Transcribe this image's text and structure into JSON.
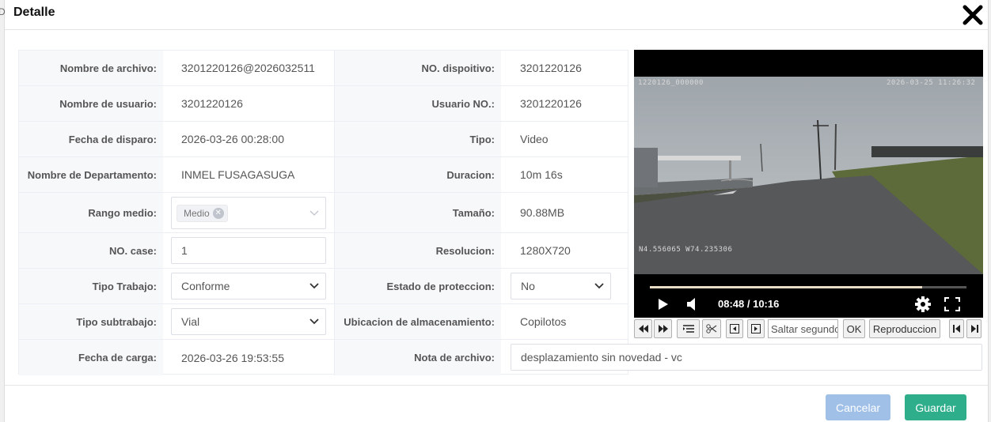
{
  "dialog": {
    "title": "Detalle",
    "close_icon": "close-x-icon"
  },
  "form": {
    "rows": [
      {
        "left_label": "Nombre de archivo:",
        "left_value": "3201220126@2026032511",
        "right_label": "NO. dispoitivo:",
        "right_value": "3201220126"
      },
      {
        "left_label": "Nombre de usuario:",
        "left_value": "3201220126",
        "right_label": "Usuario NO.:",
        "right_value": "3201220126"
      },
      {
        "left_label": "Fecha de disparo:",
        "left_value": "2026-03-26 00:28:00",
        "right_label": "Tipo:",
        "right_value": "Video"
      },
      {
        "left_label": "Nombre de Departamento:",
        "left_value": "INMEL FUSAGASUGA",
        "right_label": "Duracion:",
        "right_value": "10m 16s"
      },
      {
        "left_label": "Rango medio:",
        "left_value": "Medio",
        "right_label": "Tamaño:",
        "right_value": "90.88MB"
      },
      {
        "left_label": "NO. case:",
        "left_value": "1",
        "right_label": "Resolucion:",
        "right_value": "1280X720"
      },
      {
        "left_label": "Tipo Trabajo:",
        "left_value": "Conforme",
        "right_label": "Estado de proteccion:",
        "right_value": "No"
      },
      {
        "left_label": "Tipo subtrabajo:",
        "left_value": "Vial",
        "right_label": "Ubicacion de almacenamiento:",
        "right_value": "Copilotos"
      },
      {
        "left_label": "Fecha de carga:",
        "left_value": "2026-03-26 19:53:55",
        "right_label": "Nota de archivo:",
        "right_value": "desplazamiento sin novedad - vc"
      }
    ]
  },
  "video": {
    "osd_left": "1220126_000000",
    "osd_right": "2026-03-25  11:26:32",
    "osd_gps": "N4.556065  W74.235306",
    "time": "08:48 / 10:16",
    "progress": 0.86,
    "icons": [
      "play-icon",
      "volume-icon",
      "gear-icon",
      "fullscreen-icon"
    ]
  },
  "toolbar": {
    "seek_placeholder": "Saltar segundos",
    "ok_label": "OK",
    "playback_label": "Reproduccion",
    "icons": [
      "rewind-icon",
      "fast-forward-icon",
      "list-icon",
      "scissors-icon",
      "prev-frame-icon",
      "next-frame-icon",
      "skip-start-icon",
      "skip-end-icon"
    ]
  },
  "footer": {
    "cancel_label": "Cancelar",
    "save_label": "Guardar"
  },
  "colors": {
    "cancel_button": "#a0c0e8",
    "save_button": "#2fae8c",
    "label_background": "#f7f8fa"
  }
}
